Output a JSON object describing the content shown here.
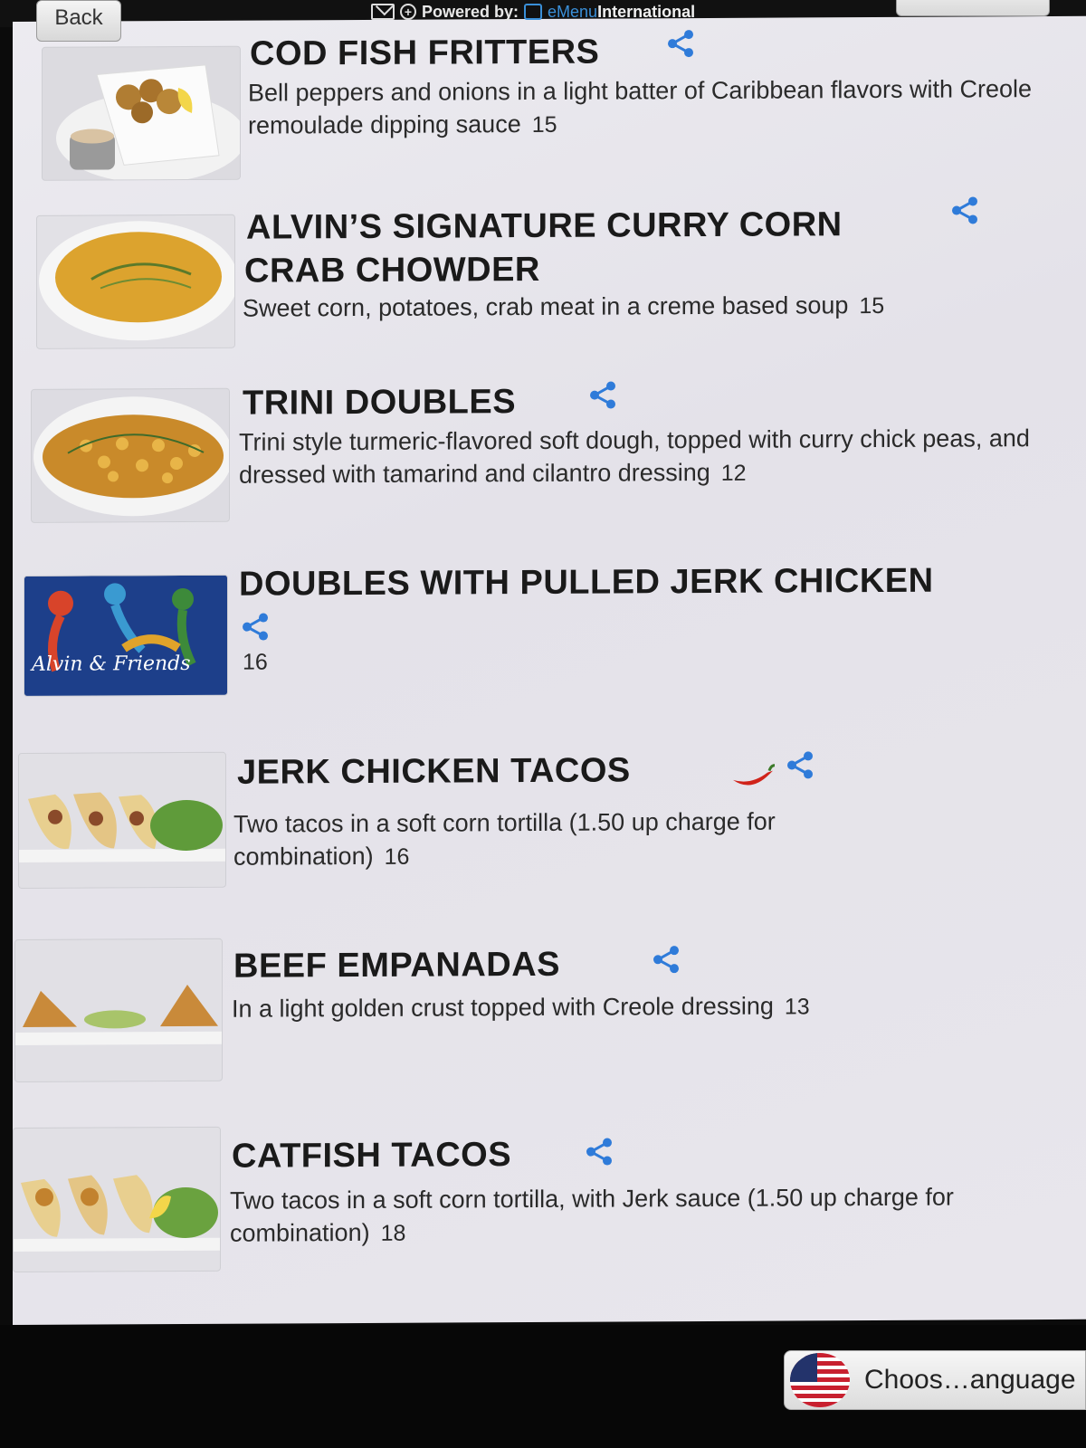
{
  "header": {
    "back_label": "Back",
    "powered_by": "Powered by:",
    "brand_e": "eMenu",
    "brand_intl": "International"
  },
  "colors": {
    "share": "#2f7bd9",
    "panel": "#ebe9ef",
    "pepper": "#d0231a"
  },
  "items": [
    {
      "name": "COD FISH FRITTERS",
      "description": "Bell peppers and onions in a light batter of Caribbean flavors with Creole remoulade dipping sauce",
      "price": "15",
      "icons": [
        "share-icon"
      ]
    },
    {
      "name": "ALVIN’S SIGNATURE CURRY CORN",
      "name_line2": "CRAB CHOWDER",
      "description": "Sweet corn, potatoes, crab meat in a creme based soup",
      "price": "15",
      "icons": [
        "share-icon"
      ]
    },
    {
      "name": "TRINI DOUBLES",
      "description": "Trini style turmeric-flavored soft dough, topped with curry chick peas, and dressed with tamarind and cilantro dressing",
      "price": "12",
      "icons": [
        "share-icon"
      ]
    },
    {
      "name": "DOUBLES WITH PULLED JERK CHICKEN",
      "description": "",
      "price": "16",
      "logo_text": "Alvin & Friends",
      "icons": [
        "share-icon"
      ]
    },
    {
      "name": "JERK CHICKEN TACOS",
      "description": "Two tacos in a soft corn tortilla (1.50 up charge for combination)",
      "price": "16",
      "icons": [
        "hot-pepper-icon",
        "share-icon"
      ]
    },
    {
      "name": "BEEF EMPANADAS",
      "description": "In a light golden crust topped with Creole dressing",
      "price": "13",
      "icons": [
        "share-icon"
      ]
    },
    {
      "name": "CATFISH TACOS",
      "description": "Two tacos in a soft corn tortilla, with Jerk sauce (1.50 up charge for combination)",
      "price": "18",
      "icons": [
        "share-icon"
      ]
    }
  ],
  "footer": {
    "language_label": "Choos…anguage",
    "flag": "us-flag-icon"
  }
}
